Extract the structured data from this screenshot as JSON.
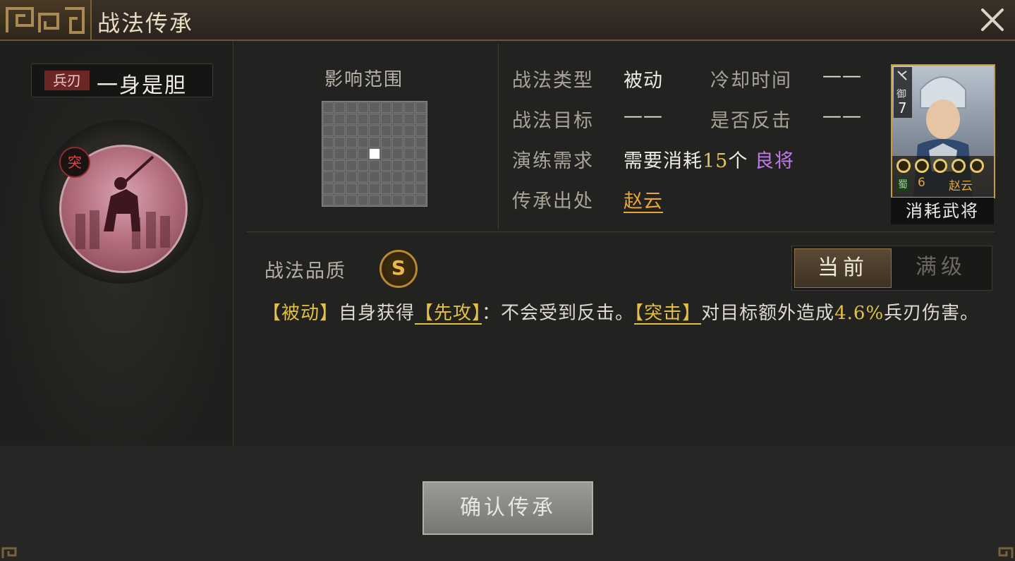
{
  "window": {
    "title": "战法传承",
    "close_icon": "close-icon"
  },
  "skill": {
    "troop_type": "兵刃",
    "name": "一身是胆",
    "badge": "突"
  },
  "range": {
    "title": "影响范围",
    "grid_cells": 9,
    "active_cell": [
      4,
      4
    ]
  },
  "info": {
    "type_label": "战法类型",
    "type_value": "被动",
    "cooldown_label": "冷却时间",
    "cooldown_value": "——",
    "target_label": "战法目标",
    "target_value": "——",
    "counter_label": "是否反击",
    "counter_value": "——",
    "req_label": "演练需求",
    "req_prefix": "需要消耗",
    "req_count": "15",
    "req_unit": "个",
    "req_kind": "良将",
    "source_label": "传承出处",
    "source_value": "赵云"
  },
  "hero_card": {
    "role": "御",
    "cost": "7",
    "faction": "蜀",
    "level": "6",
    "name": "赵云",
    "label": "消耗武将",
    "stars": 5
  },
  "quality": {
    "label": "战法品质",
    "grade": "S"
  },
  "toggle": {
    "current": "当前",
    "max": "满级"
  },
  "description": {
    "kw_passive": "【被动】",
    "part1": "自身获得",
    "kw_first_strike": "【先攻】",
    "part2": "：不会受到反击。",
    "kw_assault": "【突击】",
    "part3": "对目标额外造成",
    "pct": "4.6%",
    "part4": "兵刃伤害。"
  },
  "footer": {
    "confirm": "确认传承"
  },
  "colors": {
    "gold": "#e3c045",
    "purple": "#c07ae8",
    "orange_link": "#e9a53a",
    "troop_tag": "#6d2626"
  }
}
